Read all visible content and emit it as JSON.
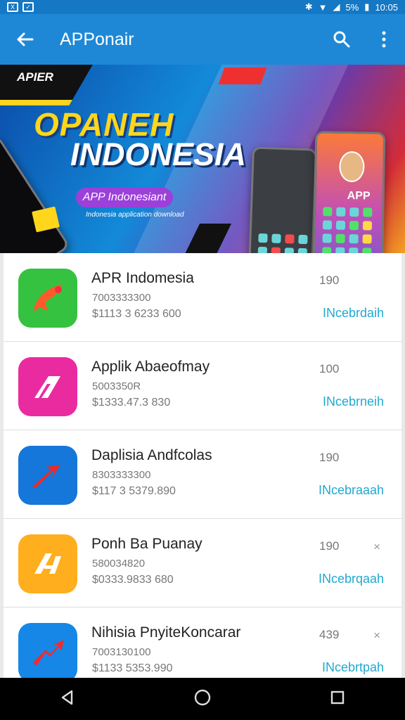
{
  "status": {
    "percent": "5%",
    "time": "10:05"
  },
  "app_bar": {
    "title": "APPonair"
  },
  "banner": {
    "ribbon_text": "APIER",
    "title_line_1": "OPANEH",
    "title_line_2": "INDONESIA",
    "pill_text": "APP Indonesiant",
    "caption": "Indonesia application download",
    "phone_label": "APP"
  },
  "apps": [
    {
      "name": "APR Indomesia",
      "meta1": "7003333300",
      "meta2": "$1113 3 6233 600",
      "score": "190",
      "status": "INcebrdaih",
      "mark": ""
    },
    {
      "name": "Applik Abaeofmay",
      "meta1": "5003350R",
      "meta2": "$1333.47.3 830",
      "score": "100",
      "status": "INcebrneih",
      "mark": ""
    },
    {
      "name": "Daplisia Andfcolas",
      "meta1": "8303333300",
      "meta2": "$117 3 5379.890",
      "score": "190",
      "status": "INcebraaah",
      "mark": ""
    },
    {
      "name": "Ponh Ba Puanay",
      "meta1": "580034820",
      "meta2": "$0333.9833 680",
      "score": "190",
      "status": "INcebrqaah",
      "mark": "×"
    },
    {
      "name": "Nihisia PnyiteKoncarar",
      "meta1": "7003130100",
      "meta2": "$1133 5353.990",
      "score": "439",
      "status": "INcebrtpah",
      "mark": "×"
    }
  ],
  "icons": {
    "app1": "phone-arrow-icon",
    "app2": "red-a-logo-icon",
    "app3": "arrow-icon",
    "app4": "orange-a-logo-icon",
    "app5": "red-arrow-icon"
  },
  "colors": {
    "primary": "#1e88d6",
    "accent": "#20a9d0",
    "app1": "#35c241",
    "app2": "#ea2ba0",
    "app3": "#1477d9",
    "app4": "#ffae1d",
    "app5": "#1687e6"
  }
}
